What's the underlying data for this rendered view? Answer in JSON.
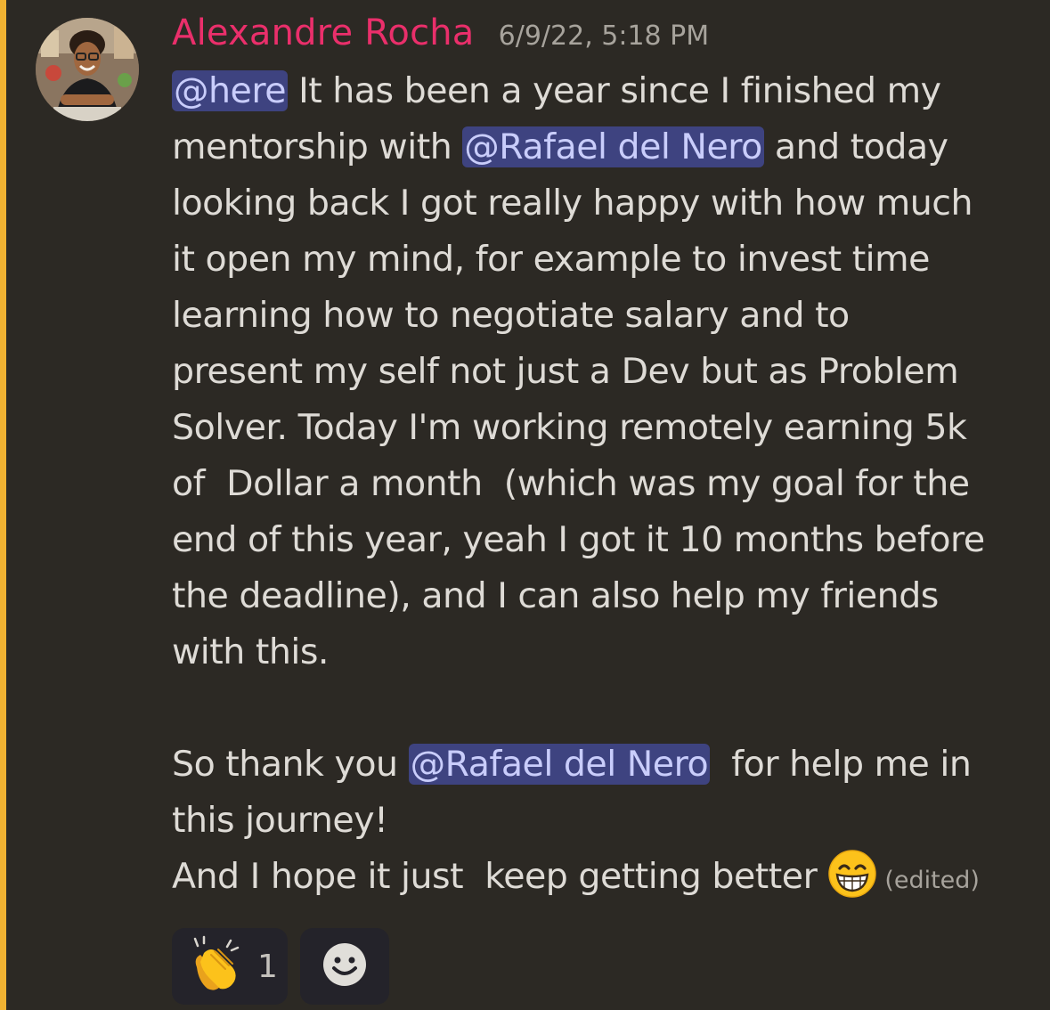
{
  "message": {
    "author": "Alexandre Rocha",
    "timestamp": "6/9/22, 5:18 PM",
    "lines": [
      {
        "mention": "@here",
        "text": " It has been a year since I finished my"
      },
      {
        "text": "mentorship with ",
        "mention": "@Rafael del Nero",
        "after": " and today"
      },
      {
        "text": "looking back I got really happy with how much"
      },
      {
        "text": "it open my mind, for example to invest time"
      },
      {
        "text": "learning how to negotiate salary and to"
      },
      {
        "text": "present my self not just a Dev but as Problem"
      },
      {
        "text": "Solver. Today I'm working remotely earning 5k"
      },
      {
        "text": "of  Dollar a month  (which was my goal for the"
      },
      {
        "text": "end of this year, yeah I got it 10 months before"
      },
      {
        "text": "the deadline), and I can also help my friends"
      },
      {
        "text": "with this."
      },
      {
        "text": ""
      },
      {
        "text": "So thank you ",
        "mention": "@Rafael del Nero",
        "after": "  for help me in"
      },
      {
        "text": "this journey!"
      },
      {
        "text": "And I hope it just  keep getting better"
      }
    ],
    "emoji": "grinning-face-with-smiling-eyes",
    "edited_label": "(edited)",
    "reactions": [
      {
        "emoji": "clapping-hands",
        "count": "1"
      },
      {
        "emoji": "add-reaction-smiley"
      }
    ]
  },
  "colors": {
    "background": "#2c2924",
    "mention_bar": "#f0b232",
    "author": "#ea2f6b",
    "mention_bg": "#3e4380",
    "mention_text": "#c9cdfb",
    "body_text": "#dedbd6",
    "muted_text": "#a7a39c",
    "reaction_bg": "#24232a"
  }
}
